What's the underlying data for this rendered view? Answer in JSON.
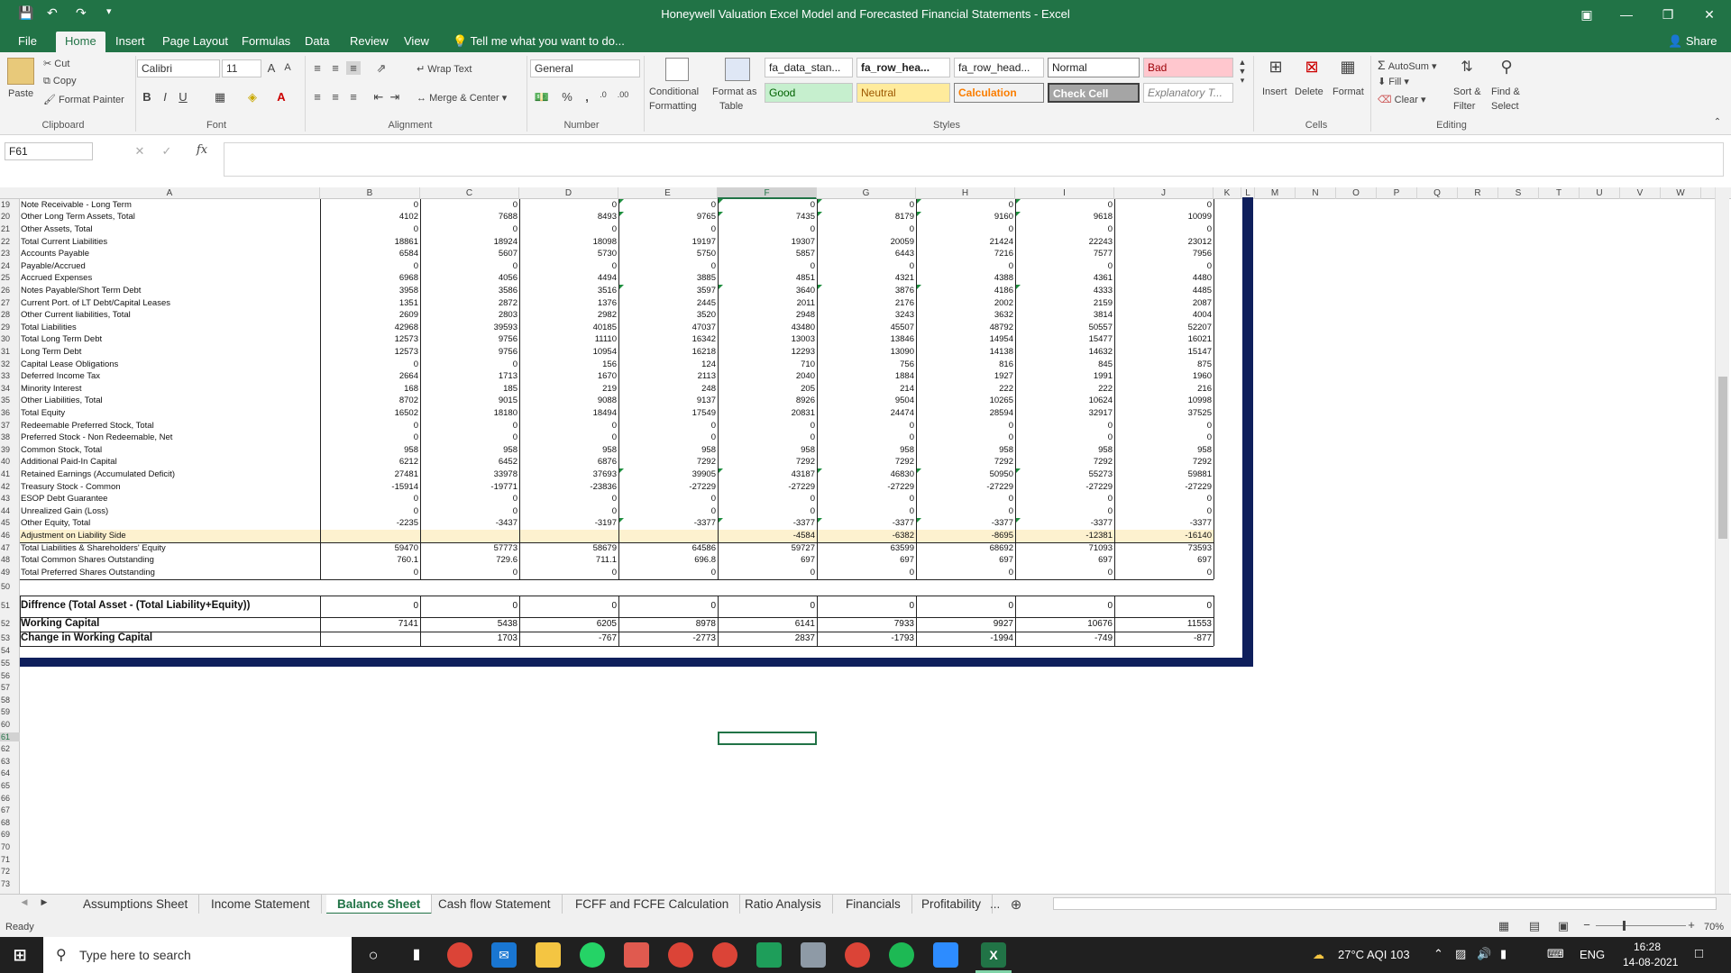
{
  "window": {
    "title": "Honeywell Valuation Excel Model and Forecasted Financial Statements - Excel",
    "share_label": "Share"
  },
  "ribbon_tabs": [
    "File",
    "Home",
    "Insert",
    "Page Layout",
    "Formulas",
    "Data",
    "Review",
    "View"
  ],
  "tell_me": "Tell me what you want to do...",
  "clipboard": {
    "paste": "Paste",
    "cut": "Cut",
    "copy": "Copy",
    "format_painter": "Format Painter",
    "group": "Clipboard"
  },
  "font": {
    "name": "Calibri",
    "size": "11",
    "group": "Font"
  },
  "alignment": {
    "wrap_text": "Wrap Text",
    "merge_center": "Merge & Center",
    "group": "Alignment"
  },
  "number": {
    "format": "General",
    "group": "Number"
  },
  "styles": {
    "conditional_formatting_1": "Conditional",
    "conditional_formatting_2": "Formatting",
    "format_as_table_1": "Format as",
    "format_as_table_2": "Table",
    "gallery": [
      "fa_data_stan...",
      "fa_row_hea...",
      "fa_row_head...",
      "Normal",
      "Bad",
      "Good",
      "Neutral",
      "Calculation",
      "Check Cell",
      "Explanatory T..."
    ],
    "group": "Styles"
  },
  "cells_group": {
    "insert": "Insert",
    "delete": "Delete",
    "format": "Format",
    "group": "Cells"
  },
  "editing": {
    "autosum": "AutoSum",
    "fill": "Fill",
    "clear": "Clear",
    "sort_filter_1": "Sort &",
    "sort_filter_2": "Filter",
    "find_select_1": "Find &",
    "find_select_2": "Select",
    "group": "Editing"
  },
  "formula_bar": {
    "name_box": "F61",
    "fx": "fx",
    "formula": ""
  },
  "columns": [
    "A",
    "B",
    "C",
    "D",
    "E",
    "F",
    "G",
    "H",
    "I",
    "J",
    "K",
    "L",
    "M",
    "N",
    "O",
    "P",
    "Q",
    "R",
    "S",
    "T",
    "U",
    "V",
    "W"
  ],
  "selected_column": "F",
  "selected_row": 61,
  "rows": [
    {
      "n": 19,
      "label": "Note Receivable - Long Term",
      "values": [
        "0",
        "0",
        "0",
        "0",
        "0",
        "0",
        "0",
        "0",
        "0"
      ]
    },
    {
      "n": 20,
      "label": "Other Long Term Assets, Total",
      "values": [
        "4102",
        "7688",
        "8493",
        "9765",
        "7435",
        "8179",
        "9160",
        "9618",
        "10099"
      ]
    },
    {
      "n": 21,
      "label": "Other Assets, Total",
      "values": [
        "0",
        "0",
        "0",
        "0",
        "0",
        "0",
        "0",
        "0",
        "0"
      ]
    },
    {
      "n": 22,
      "label": "Total Current Liabilities",
      "values": [
        "18861",
        "18924",
        "18098",
        "19197",
        "19307",
        "20059",
        "21424",
        "22243",
        "23012"
      ]
    },
    {
      "n": 23,
      "label": "Accounts Payable",
      "values": [
        "6584",
        "5607",
        "5730",
        "5750",
        "5857",
        "6443",
        "7216",
        "7577",
        "7956"
      ]
    },
    {
      "n": 24,
      "label": "Payable/Accrued",
      "values": [
        "0",
        "0",
        "0",
        "0",
        "0",
        "0",
        "0",
        "0",
        "0"
      ]
    },
    {
      "n": 25,
      "label": "Accrued Expenses",
      "values": [
        "6968",
        "4056",
        "4494",
        "3885",
        "4851",
        "4321",
        "4388",
        "4361",
        "4480"
      ]
    },
    {
      "n": 26,
      "label": "Notes Payable/Short Term Debt",
      "values": [
        "3958",
        "3586",
        "3516",
        "3597",
        "3640",
        "3876",
        "4186",
        "4333",
        "4485"
      ]
    },
    {
      "n": 27,
      "label": "Current Port. of LT Debt/Capital Leases",
      "values": [
        "1351",
        "2872",
        "1376",
        "2445",
        "2011",
        "2176",
        "2002",
        "2159",
        "2087"
      ]
    },
    {
      "n": 28,
      "label": "Other Current liabilities, Total",
      "values": [
        "2609",
        "2803",
        "2982",
        "3520",
        "2948",
        "3243",
        "3632",
        "3814",
        "4004"
      ]
    },
    {
      "n": 29,
      "label": "Total Liabilities",
      "values": [
        "42968",
        "39593",
        "40185",
        "47037",
        "43480",
        "45507",
        "48792",
        "50557",
        "52207"
      ]
    },
    {
      "n": 30,
      "label": "Total Long Term Debt",
      "values": [
        "12573",
        "9756",
        "11110",
        "16342",
        "13003",
        "13846",
        "14954",
        "15477",
        "16021"
      ]
    },
    {
      "n": 31,
      "label": "Long Term Debt",
      "values": [
        "12573",
        "9756",
        "10954",
        "16218",
        "12293",
        "13090",
        "14138",
        "14632",
        "15147"
      ]
    },
    {
      "n": 32,
      "label": "Capital Lease Obligations",
      "values": [
        "0",
        "0",
        "156",
        "124",
        "710",
        "756",
        "816",
        "845",
        "875"
      ]
    },
    {
      "n": 33,
      "label": "Deferred Income Tax",
      "values": [
        "2664",
        "1713",
        "1670",
        "2113",
        "2040",
        "1884",
        "1927",
        "1991",
        "1960"
      ]
    },
    {
      "n": 34,
      "label": "Minority Interest",
      "values": [
        "168",
        "185",
        "219",
        "248",
        "205",
        "214",
        "222",
        "222",
        "216"
      ]
    },
    {
      "n": 35,
      "label": "Other Liabilities, Total",
      "values": [
        "8702",
        "9015",
        "9088",
        "9137",
        "8926",
        "9504",
        "10265",
        "10624",
        "10998"
      ]
    },
    {
      "n": 36,
      "label": "Total Equity",
      "values": [
        "16502",
        "18180",
        "18494",
        "17549",
        "20831",
        "24474",
        "28594",
        "32917",
        "37525"
      ]
    },
    {
      "n": 37,
      "label": "Redeemable Preferred Stock, Total",
      "values": [
        "0",
        "0",
        "0",
        "0",
        "0",
        "0",
        "0",
        "0",
        "0"
      ]
    },
    {
      "n": 38,
      "label": "Preferred Stock - Non Redeemable, Net",
      "values": [
        "0",
        "0",
        "0",
        "0",
        "0",
        "0",
        "0",
        "0",
        "0"
      ]
    },
    {
      "n": 39,
      "label": "Common Stock, Total",
      "values": [
        "958",
        "958",
        "958",
        "958",
        "958",
        "958",
        "958",
        "958",
        "958"
      ]
    },
    {
      "n": 40,
      "label": "Additional Paid-In Capital",
      "values": [
        "6212",
        "6452",
        "6876",
        "7292",
        "7292",
        "7292",
        "7292",
        "7292",
        "7292"
      ]
    },
    {
      "n": 41,
      "label": "Retained Earnings (Accumulated Deficit)",
      "values": [
        "27481",
        "33978",
        "37693",
        "39905",
        "43187",
        "46830",
        "50950",
        "55273",
        "59881"
      ]
    },
    {
      "n": 42,
      "label": "Treasury Stock - Common",
      "values": [
        "-15914",
        "-19771",
        "-23836",
        "-27229",
        "-27229",
        "-27229",
        "-27229",
        "-27229",
        "-27229"
      ]
    },
    {
      "n": 43,
      "label": "ESOP Debt Guarantee",
      "values": [
        "0",
        "0",
        "0",
        "0",
        "0",
        "0",
        "0",
        "0",
        "0"
      ]
    },
    {
      "n": 44,
      "label": "Unrealized Gain (Loss)",
      "values": [
        "0",
        "0",
        "0",
        "0",
        "0",
        "0",
        "0",
        "0",
        "0"
      ]
    },
    {
      "n": 45,
      "label": "Other Equity, Total",
      "values": [
        "-2235",
        "-3437",
        "-3197",
        "-3377",
        "-3377",
        "-3377",
        "-3377",
        "-3377",
        "-3377"
      ]
    },
    {
      "n": 46,
      "label": "Adjustment on Liability Side",
      "values": [
        "",
        "",
        "",
        "",
        "-4584",
        "-6382",
        "-8695",
        "-12381",
        "-16140"
      ],
      "highlight": true
    },
    {
      "n": 47,
      "label": "Total Liabilities & Shareholders' Equity",
      "values": [
        "59470",
        "57773",
        "58679",
        "64586",
        "59727",
        "63599",
        "68692",
        "71093",
        "73593"
      ]
    },
    {
      "n": 48,
      "label": "Total Common Shares Outstanding",
      "values": [
        "760.1",
        "729.6",
        "711.1",
        "696.8",
        "697",
        "697",
        "697",
        "697",
        "697"
      ]
    },
    {
      "n": 49,
      "label": "Total Preferred Shares Outstanding",
      "values": [
        "0",
        "0",
        "0",
        "0",
        "0",
        "0",
        "0",
        "0",
        "0"
      ]
    },
    {
      "n": 50,
      "label": "",
      "values": []
    },
    {
      "n": 51,
      "label": "Diffrence (Total Asset - (Total Liability+Equity))",
      "values": [
        "0",
        "0",
        "0",
        "0",
        "0",
        "0",
        "0",
        "0",
        "0"
      ],
      "bold": true
    },
    {
      "n": 52,
      "label": "Working Capital",
      "values": [
        "7141",
        "5438",
        "6205",
        "8978",
        "6141",
        "7933",
        "9927",
        "10676",
        "11553"
      ],
      "bold": true
    },
    {
      "n": 53,
      "label": "Change in Working Capital",
      "values": [
        "",
        "1703",
        "-767",
        "-2773",
        "2837",
        "-1793",
        "-1994",
        "-749",
        "-877"
      ],
      "bold": true
    }
  ],
  "empty_rows": [
    54,
    55,
    56,
    57,
    58,
    59,
    60,
    61,
    62,
    63,
    64,
    65,
    66,
    67,
    68,
    69,
    70,
    71,
    72,
    73
  ],
  "sheet_tabs": [
    "Assumptions Sheet",
    "Income Statement",
    "Balance Sheet",
    "Cash flow Statement",
    "FCFF and FCFE Calculation",
    "Ratio Analysis",
    "Financials",
    "Profitability"
  ],
  "active_sheet": "Balance Sheet",
  "more_sheets": "...",
  "status": {
    "ready": "Ready",
    "zoom": "70%"
  },
  "taskbar": {
    "search_placeholder": "Type here to search",
    "weather": "27°C  AQI 103",
    "lang": "ENG",
    "time": "16:28",
    "date": "14-08-2021"
  },
  "colors": {
    "excel_green": "#217346",
    "frame_navy": "#0f1f5c",
    "highlight_row": "#fdf1cf"
  }
}
